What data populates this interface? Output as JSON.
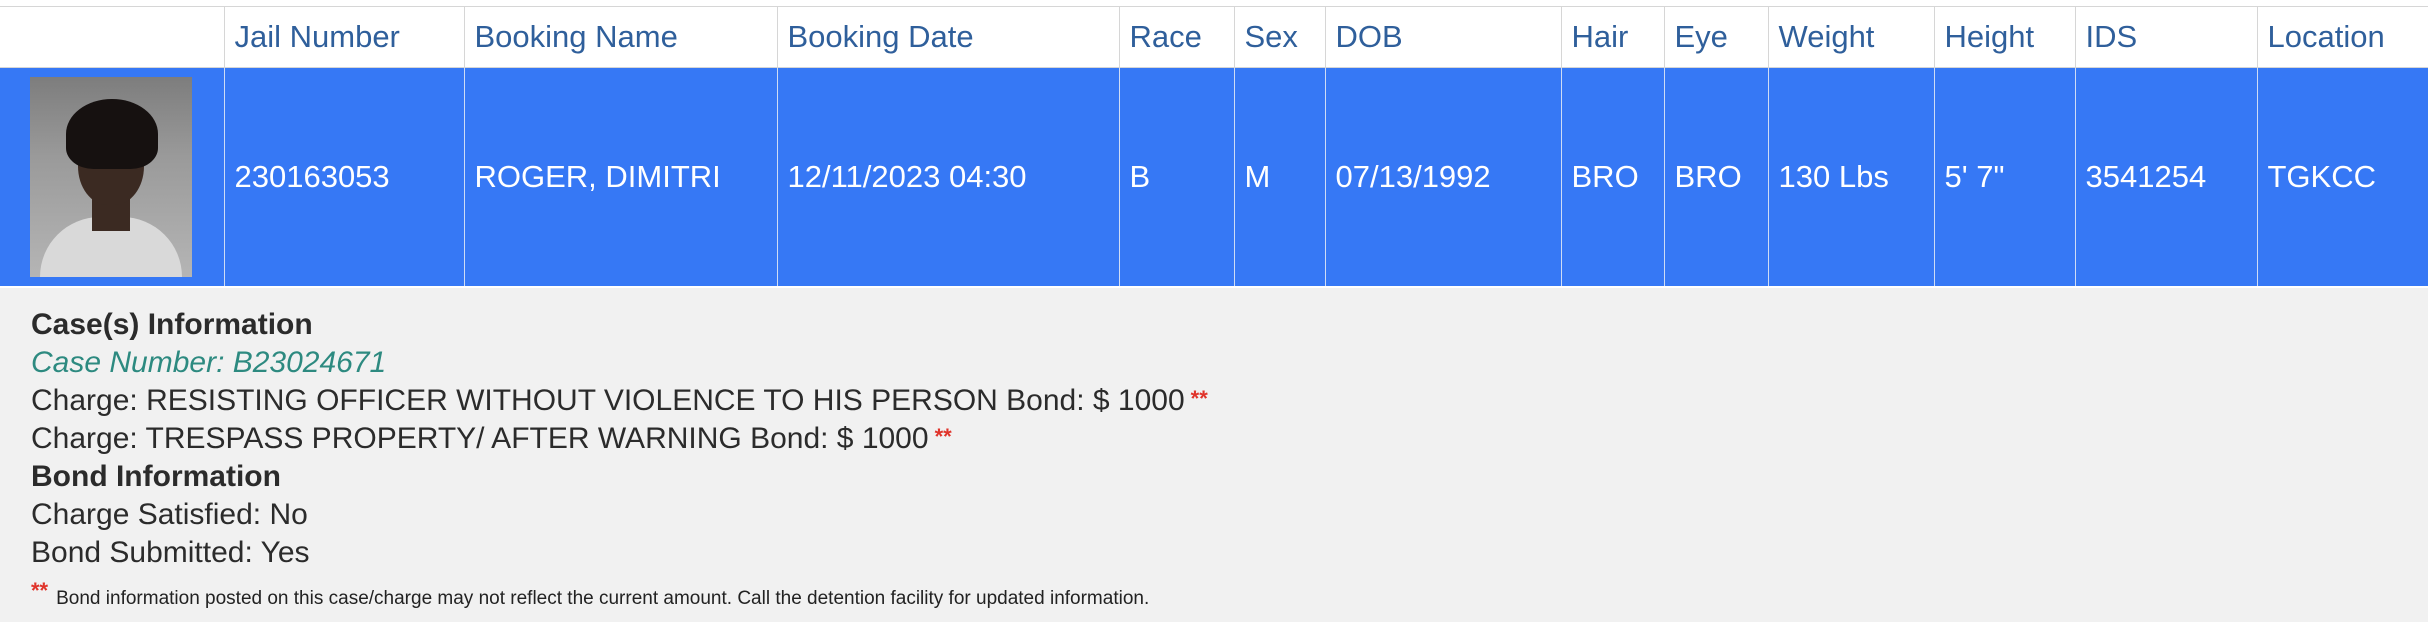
{
  "table": {
    "headers": [
      "",
      "Jail Number",
      "Booking Name",
      "Booking Date",
      "Race",
      "Sex",
      "DOB",
      "Hair",
      "Eye",
      "Weight",
      "Height",
      "IDS",
      "Location"
    ],
    "row": {
      "jail_number": "230163053",
      "booking_name": "ROGER, DIMITRI",
      "booking_date": "12/11/2023 04:30",
      "race": "B",
      "sex": "M",
      "dob": "07/13/1992",
      "hair": "BRO",
      "eye": "BRO",
      "weight": "130 Lbs",
      "height": "5' 7\"",
      "ids": "3541254",
      "location": "TGKCC"
    }
  },
  "cases": {
    "heading": "Case(s) Information",
    "case_number": "Case Number: B23024671",
    "charges": [
      "Charge: RESISTING OFFICER WITHOUT VIOLENCE TO HIS PERSON Bond: $ 1000",
      "Charge: TRESPASS PROPERTY/ AFTER WARNING Bond: $ 1000"
    ],
    "bond_marker": "**"
  },
  "bond": {
    "heading": "Bond Information",
    "charge_satisfied": "Charge Satisfied: No",
    "bond_submitted": "Bond Submitted: Yes"
  },
  "footnote": {
    "marker": "**",
    "text": "Bond information posted on this case/charge may not reflect the current amount. Call the detention facility for updated information."
  },
  "colors": {
    "row_background": "#3678f5",
    "header_text": "#2f5f9b",
    "case_number_text": "#2d8a80",
    "marker": "#e0342b",
    "details_background": "#f1f1f1"
  }
}
